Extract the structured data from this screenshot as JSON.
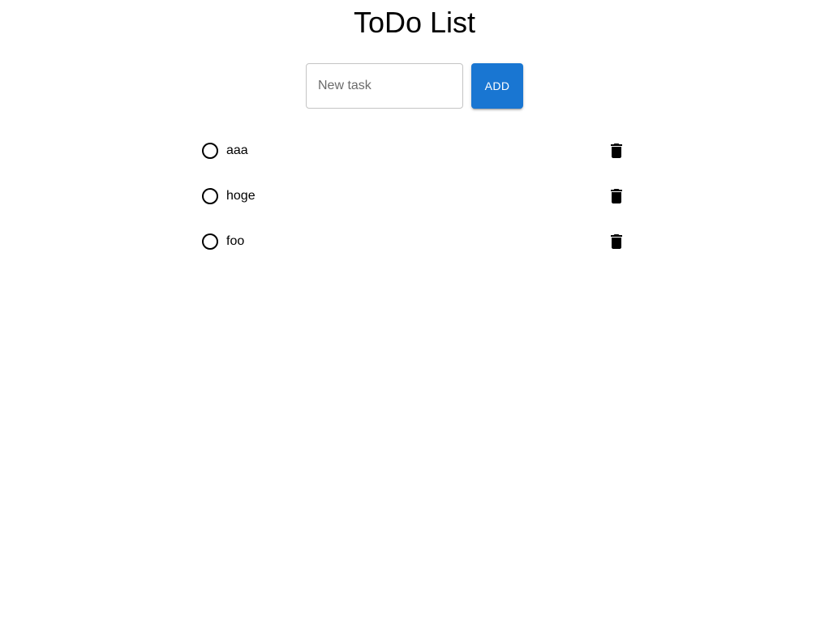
{
  "header": {
    "title": "ToDo List"
  },
  "form": {
    "input_value": "",
    "input_placeholder": "New task",
    "add_label": "ADD",
    "accent_color": "#1976d2"
  },
  "todos": [
    {
      "text": "aaa",
      "completed": false,
      "delete_icon": "trash-icon",
      "status_icon": "radio-unchecked-icon"
    },
    {
      "text": "hoge",
      "completed": false,
      "delete_icon": "trash-icon",
      "status_icon": "radio-unchecked-icon"
    },
    {
      "text": "foo",
      "completed": false,
      "delete_icon": "trash-icon",
      "status_icon": "radio-unchecked-icon"
    }
  ]
}
